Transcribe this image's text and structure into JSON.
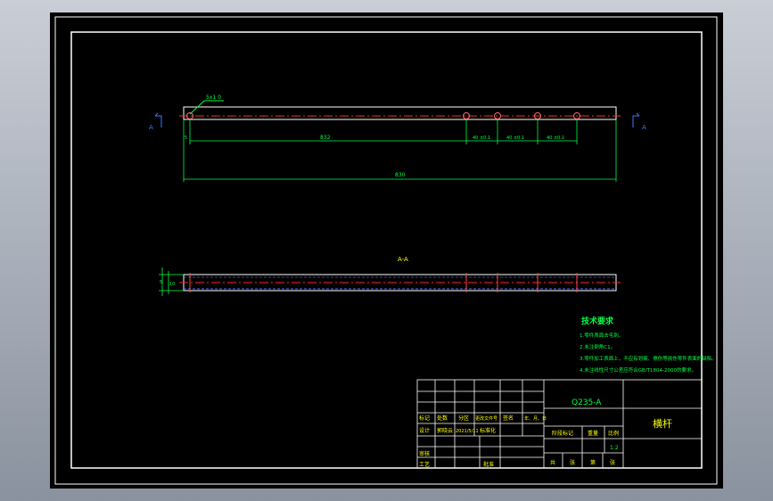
{
  "colors": {
    "background": "#000000",
    "frame": "#ffffff",
    "centerline": "#ff2a2a",
    "dimension": "#00ff44",
    "section_marker": "#3a7cff",
    "annotation": "#ffff00",
    "hidden_line": "#4f6cff"
  },
  "drawing": {
    "hole_callout": "5x1 0",
    "section_letter_left": "A",
    "section_letter_right": "A",
    "section_label": "A-A",
    "dim_left": "5",
    "dim_main": "832",
    "dim_spacings": [
      "40 ±0.1",
      "40 ±0.1",
      "40 ±0.1"
    ],
    "dim_total": "830",
    "side_dims": [
      "5",
      "10"
    ]
  },
  "notes": {
    "title": "技术要求",
    "items": [
      "1.零件表面去毛刺。",
      "2.未注倒角C1。",
      "3.零件加工表面上，不应有划痕、擦伤等损伤零件表面的缺陷。",
      "4.未注线性尺寸公差应符合GB/T1804-2000的要求。"
    ]
  },
  "title_block": {
    "material": "Q235-A",
    "part_name": "横杆",
    "row_header": [
      "标记",
      "处数",
      "分区",
      "更改文件号",
      "签名",
      "年、月、日"
    ],
    "design_row": [
      "设计",
      "郭晓云",
      "2021/5/11",
      "标准化"
    ],
    "stage_headers": [
      "阶段标记",
      "重量",
      "比例"
    ],
    "scale": "1:2",
    "audit": "审核",
    "process": "工艺",
    "approve": "批准",
    "sheet_row": [
      "共",
      "张",
      "第",
      "张"
    ]
  }
}
